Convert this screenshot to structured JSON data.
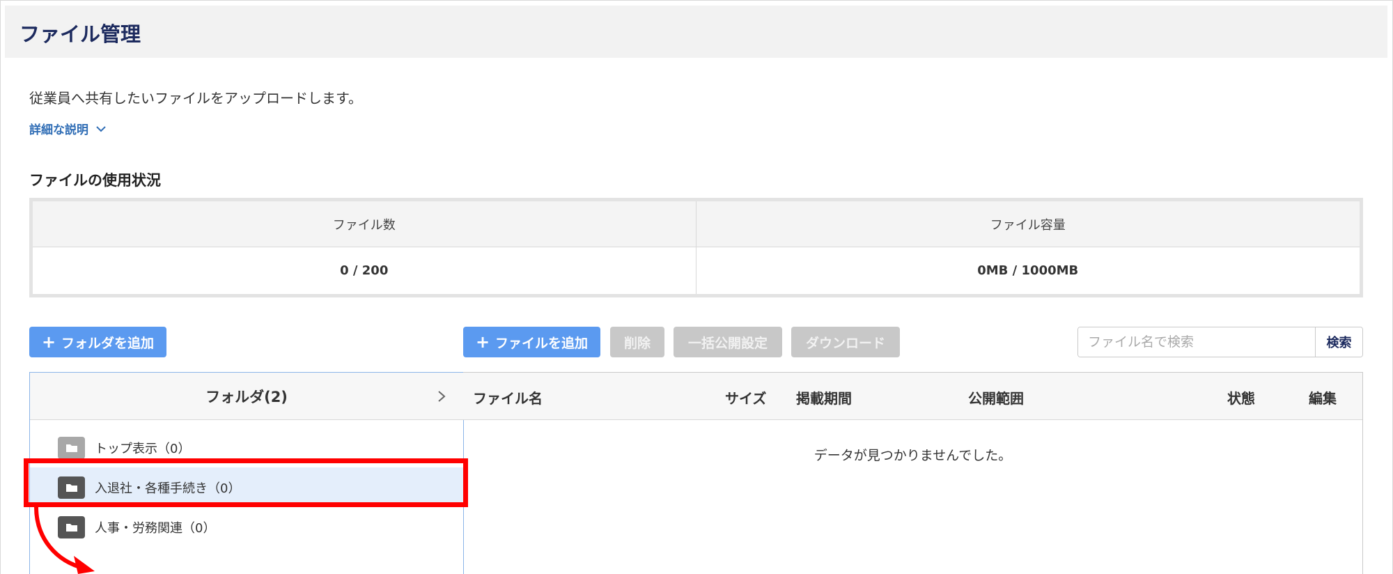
{
  "header": {
    "title": "ファイル管理"
  },
  "intro": {
    "description": "従業員へ共有したいファイルをアップロードします。",
    "detail_link": "詳細な説明"
  },
  "usage": {
    "title": "ファイルの使用状況",
    "headers": [
      "ファイル数",
      "ファイル容量"
    ],
    "values": [
      "0 / 200",
      "0MB / 1000MB"
    ]
  },
  "toolbar": {
    "add_folder": "フォルダを追加",
    "add_file": "ファイルを追加",
    "delete": "削除",
    "bulk_publish": "一括公開設定",
    "download": "ダウンロード",
    "search_placeholder": "ファイル名で検索",
    "search_button": "検索"
  },
  "folders": {
    "header": "フォルダ(2)",
    "items": [
      {
        "label": "トップ表示（0）",
        "selected": false
      },
      {
        "label": "入退社・各種手続き（0）",
        "selected": true
      },
      {
        "label": "人事・労務関連（0）",
        "selected": false
      }
    ]
  },
  "files": {
    "columns": [
      "ファイル名",
      "サイズ",
      "掲載期間",
      "公開範囲",
      "状態",
      "編集"
    ],
    "empty_message": "データが見つかりませんでした。"
  },
  "colors": {
    "primary": "#5b9af0",
    "disabled": "#c8c8c8",
    "title": "#1c2a5e",
    "link": "#2f6db5",
    "highlight": "#ff0000",
    "selected_row": "#e4eefb"
  }
}
